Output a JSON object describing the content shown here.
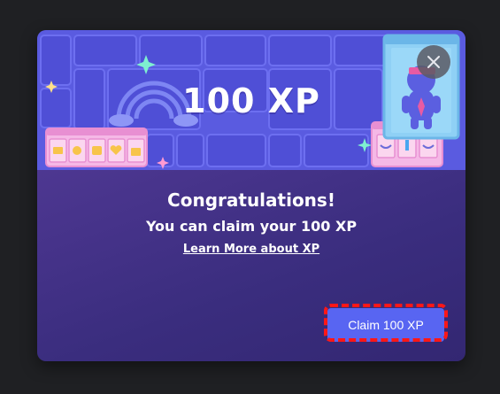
{
  "banner": {
    "xp_text": "100 XP"
  },
  "dialog": {
    "title": "Congratulations!",
    "subtitle": "You can claim your 100 XP",
    "learn_more": "Learn More about XP",
    "claim_label": "Claim 100 XP",
    "close_icon": "close-icon"
  },
  "colors": {
    "accent": "#5865f2",
    "banner_bg": "#5a5be0",
    "highlight": "#ff1717"
  }
}
